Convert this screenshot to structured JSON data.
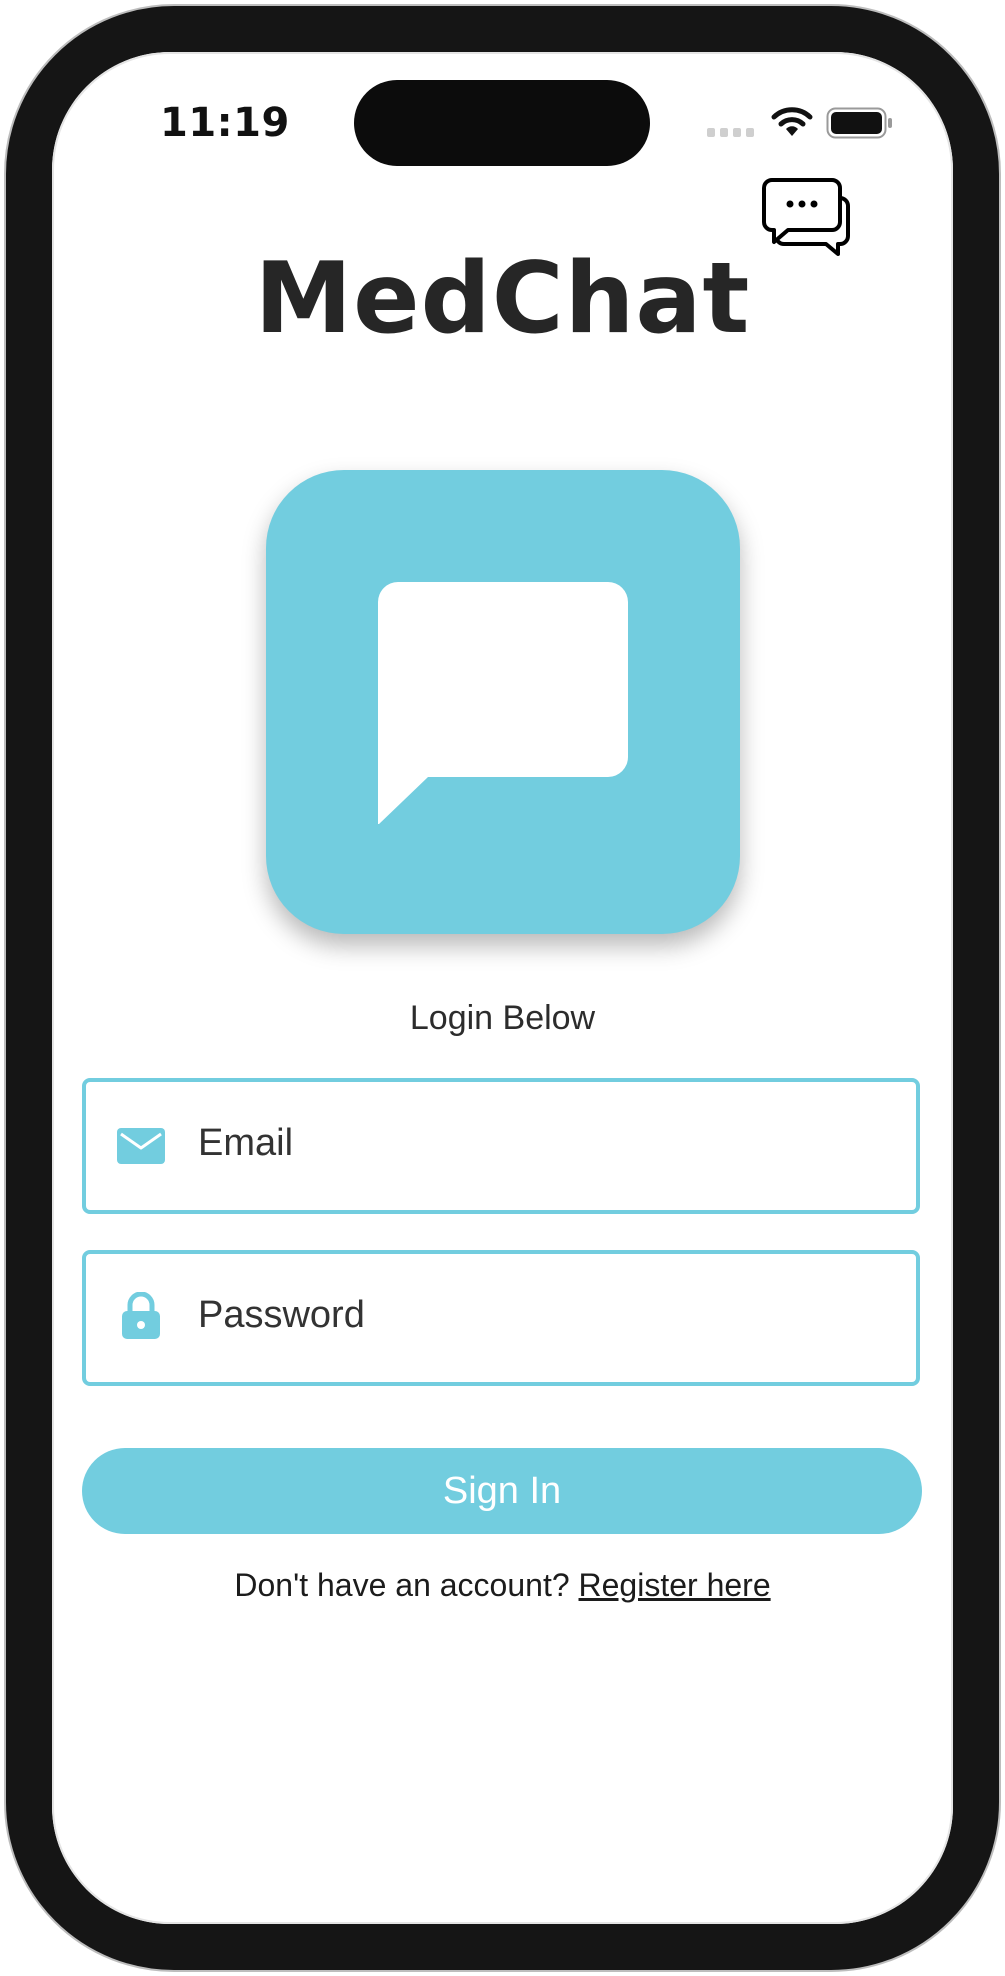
{
  "status_bar": {
    "time": "11:19"
  },
  "header": {
    "app_title": "MedChat"
  },
  "login": {
    "caption": "Login Below",
    "email": {
      "placeholder": "Email",
      "value": ""
    },
    "password": {
      "placeholder": "Password",
      "value": ""
    },
    "sign_in_label": "Sign In",
    "register_prompt": "Don't have an account?",
    "register_link": "Register here"
  },
  "icons": {
    "chat": "chat-bubbles-icon",
    "logo": "speech-bubble-icon",
    "email": "envelope-icon",
    "password": "lock-icon",
    "wifi": "wifi-icon",
    "battery": "battery-icon",
    "signal": "signal-icon"
  },
  "colors": {
    "accent": "#72cddf",
    "frame": "#151515",
    "title_text": "#262626",
    "button_text": "#ffffff"
  }
}
